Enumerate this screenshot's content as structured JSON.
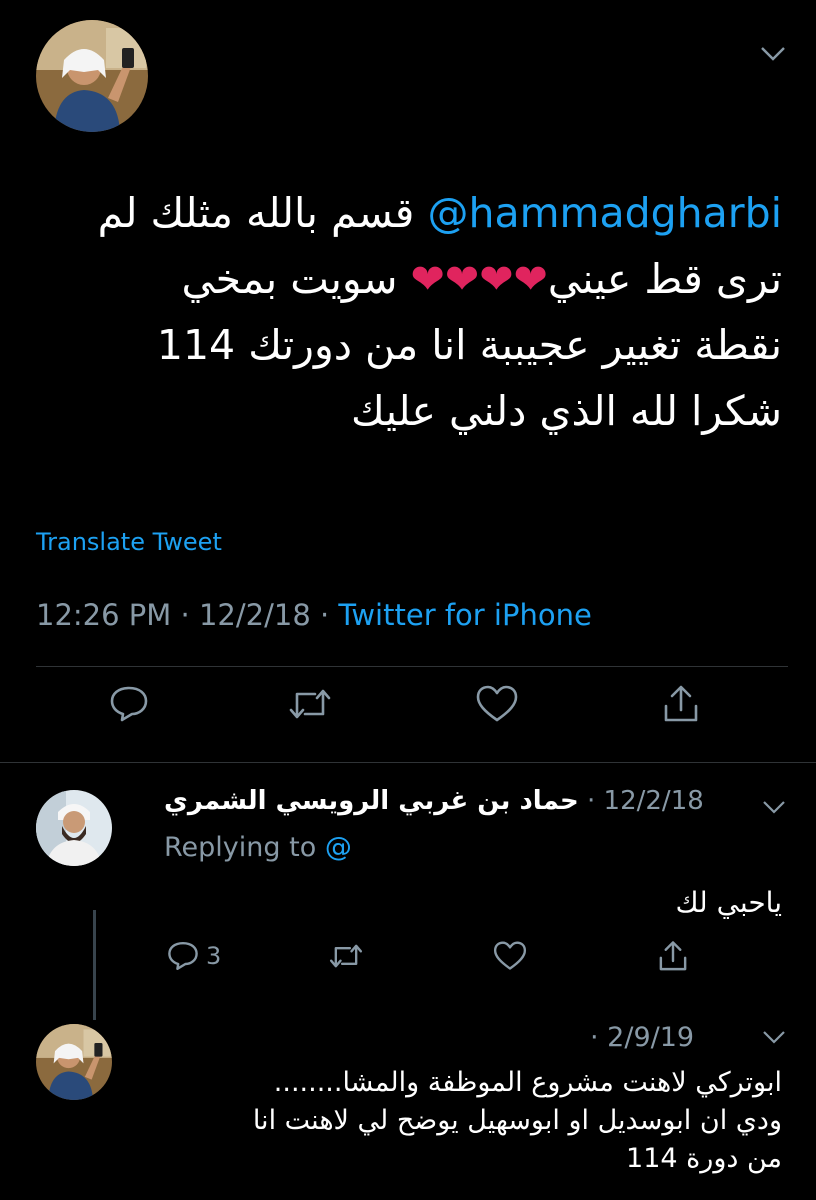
{
  "main_tweet": {
    "mention": "@hammadgharbi",
    "text_line1": "قسم بالله مثلك لم",
    "text_line2_start": "ترى قط عيني",
    "hearts": "❤❤❤❤",
    "text_line2_end": "سويت بمخي",
    "text_line3": "نقطة تغيير عجيببة انا من دورتك 114",
    "text_line4": "شكرا لله الذي دلني عليك",
    "translate_label": "Translate Tweet",
    "time": "12:26 PM",
    "date": "12/2/18",
    "source": "Twitter for iPhone"
  },
  "reply": {
    "name": "حماد بن غربي الرويسي الشمري",
    "date": "12/2/18",
    "replying_label": "Replying to",
    "replying_handle": "@",
    "text": "ياحبي لك",
    "reply_count": "3"
  },
  "reply2": {
    "date": "2/9/19",
    "text_line1": "ابوتركي لاهنت مشروع الموظفة والمشا........",
    "text_line2": "ودي ان ابوسديل او ابوسهيل يوضح لي لاهنت انا",
    "text_line3": "من دورة 114"
  },
  "colors": {
    "background": "#000000",
    "accent_blue": "#1da1f2",
    "muted_gray": "#8899a6",
    "heart_red": "#e0245e"
  },
  "icons": [
    "chevron-down-icon",
    "reply-icon",
    "retweet-icon",
    "like-icon",
    "share-icon"
  ]
}
